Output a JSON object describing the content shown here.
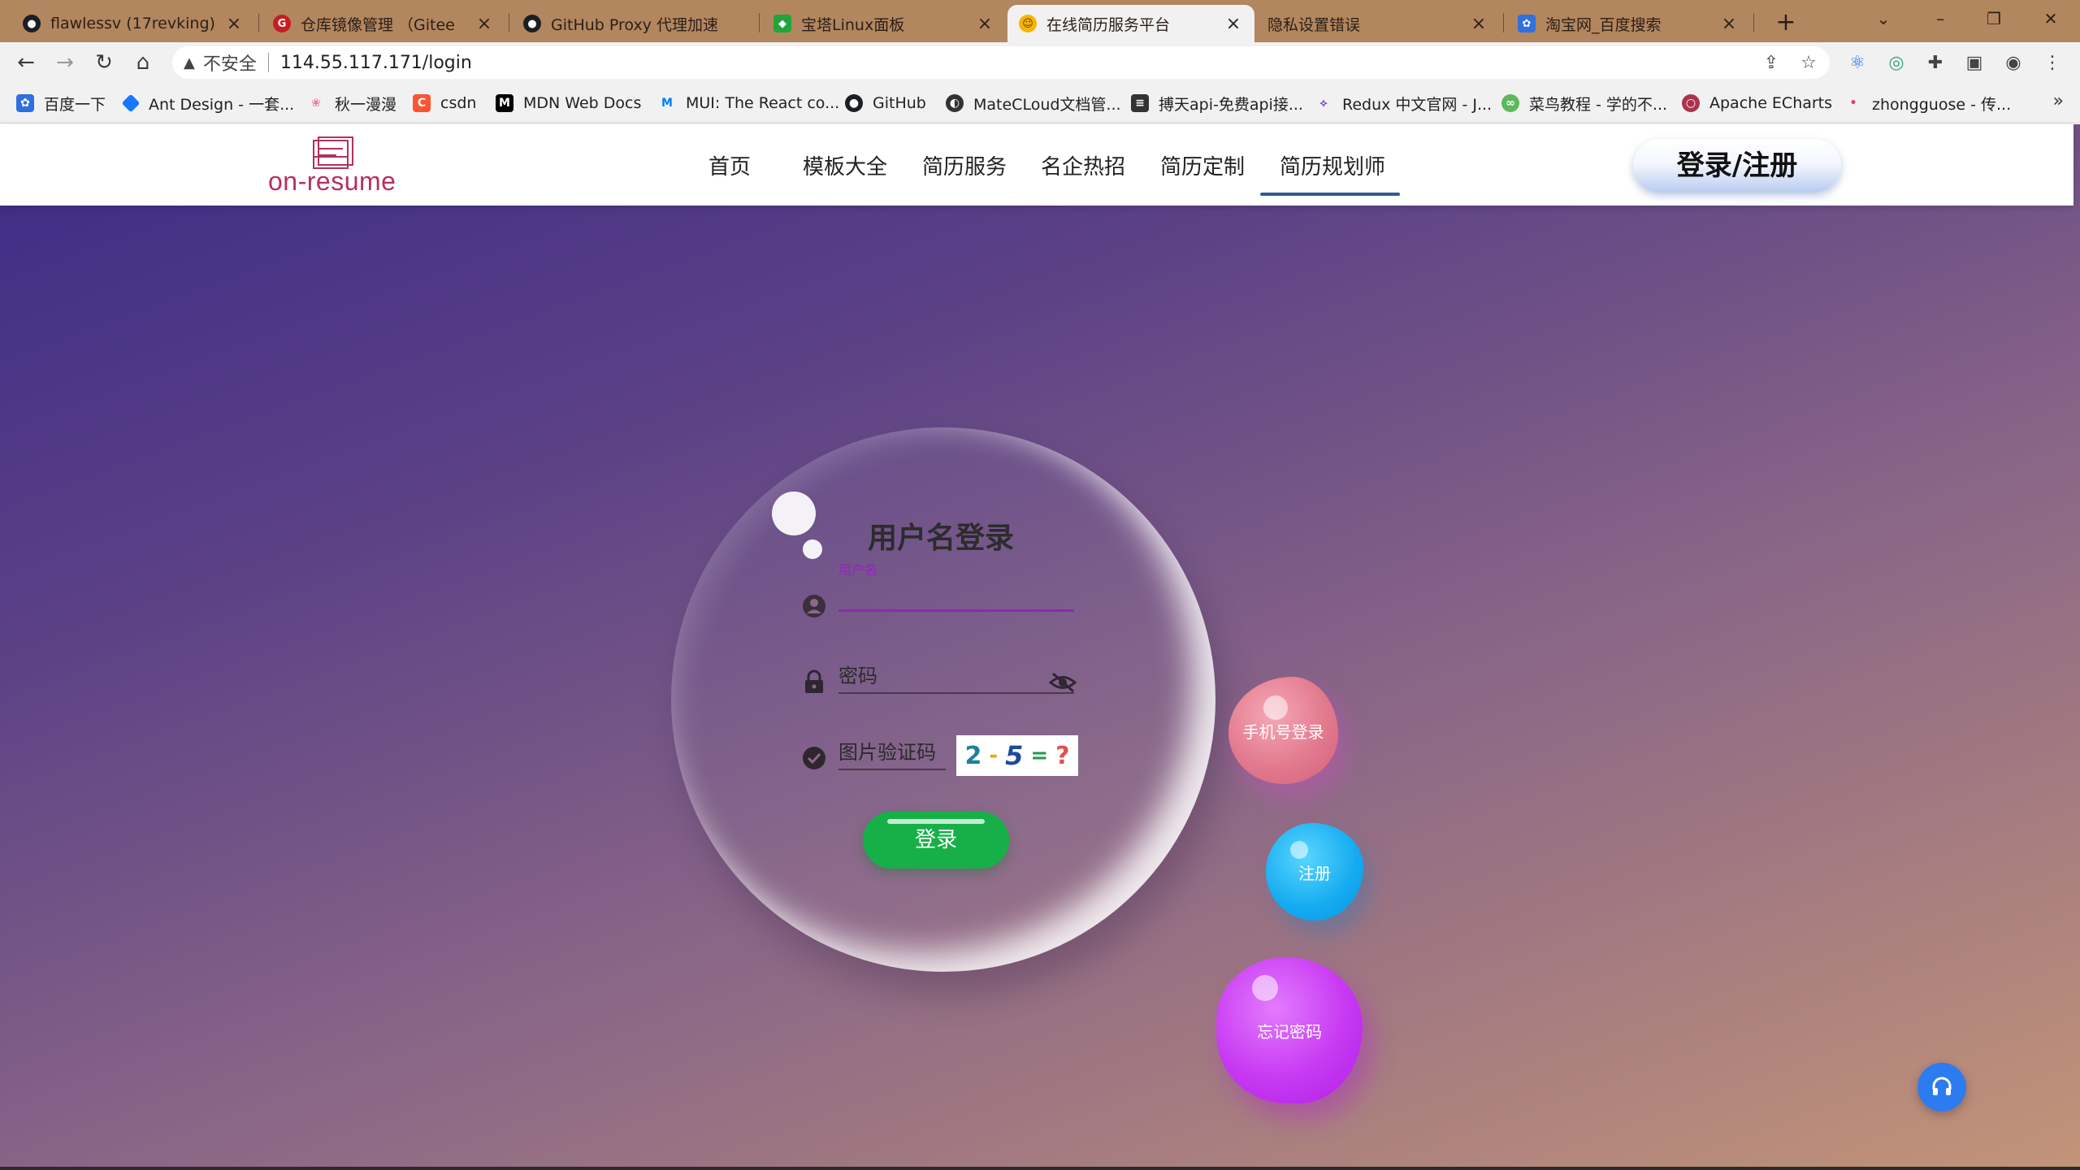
{
  "browser": {
    "tabs": [
      {
        "label": "flawlessv (17revking)",
        "icon": "github-icon"
      },
      {
        "label": "仓库镜像管理 （Gitee",
        "icon": "gitee-icon"
      },
      {
        "label": "GitHub Proxy 代理加速",
        "icon": "github-icon"
      },
      {
        "label": "宝塔Linux面板",
        "icon": "baota-icon"
      },
      {
        "label": "在线简历服务平台",
        "icon": "smile-icon"
      },
      {
        "label": "隐私设置错误",
        "icon": "none"
      },
      {
        "label": "淘宝网_百度搜索",
        "icon": "baidu-icon"
      }
    ],
    "active_tab": 4,
    "address": {
      "insecure_label": "不安全",
      "url": "114.55.117.171/login"
    },
    "bookmarks": [
      {
        "label": "百度一下",
        "icon": "baidu-icon",
        "color": "#2f6fe0"
      },
      {
        "label": "Ant Design - 一套...",
        "icon": "antd-icon",
        "color": "#1677ff"
      },
      {
        "label": "秋一漫漫",
        "icon": "flower-icon",
        "color": "#e87aa8"
      },
      {
        "label": "csdn",
        "icon": "csdn-icon",
        "color": "#fc5531"
      },
      {
        "label": "MDN Web Docs",
        "icon": "mdn-icon",
        "color": "#000000"
      },
      {
        "label": "MUI: The React co...",
        "icon": "mui-icon",
        "color": "#007fff"
      },
      {
        "label": "GitHub",
        "icon": "github-icon",
        "color": "#1b1f23"
      },
      {
        "label": "MateCLoud文档管...",
        "icon": "globe-icon",
        "color": "#333333"
      },
      {
        "label": "搏天api-免费api接...",
        "icon": "api-icon",
        "color": "#333333"
      },
      {
        "label": "Redux 中文官网 - J...",
        "icon": "redux-icon",
        "color": "#764abc"
      },
      {
        "label": "菜鸟教程 - 学的不...",
        "icon": "runoob-icon",
        "color": "#5cb85c"
      },
      {
        "label": "Apache ECharts",
        "icon": "echarts-icon",
        "color": "#aa344d"
      },
      {
        "label": "zhongguose - 传...",
        "icon": "dot-icon",
        "color": "#e23b6b"
      }
    ],
    "more_bookmarks": "»"
  },
  "site": {
    "logo_text": "on-resume",
    "nav": [
      "首页",
      "模板大全",
      "简历服务",
      "名企热招",
      "简历定制",
      "简历规划师"
    ],
    "active_nav": 5,
    "login_register": "登录/注册"
  },
  "login": {
    "title": "用户名登录",
    "username_label": "用户名",
    "username_value": "",
    "password_placeholder": "密码",
    "captcha_placeholder": "图片验证码",
    "captcha_chars": [
      "2",
      "-",
      "5",
      "=",
      "?"
    ],
    "submit": "登录"
  },
  "side_actions": {
    "phone_login": "手机号登录",
    "register": "注册",
    "forgot": "忘记密码"
  },
  "colors": {
    "accent_purple": "#8c28b4",
    "submit_green": "#17b048",
    "nav_underline": "#2f5b95",
    "logo_red": "#b5305e"
  }
}
